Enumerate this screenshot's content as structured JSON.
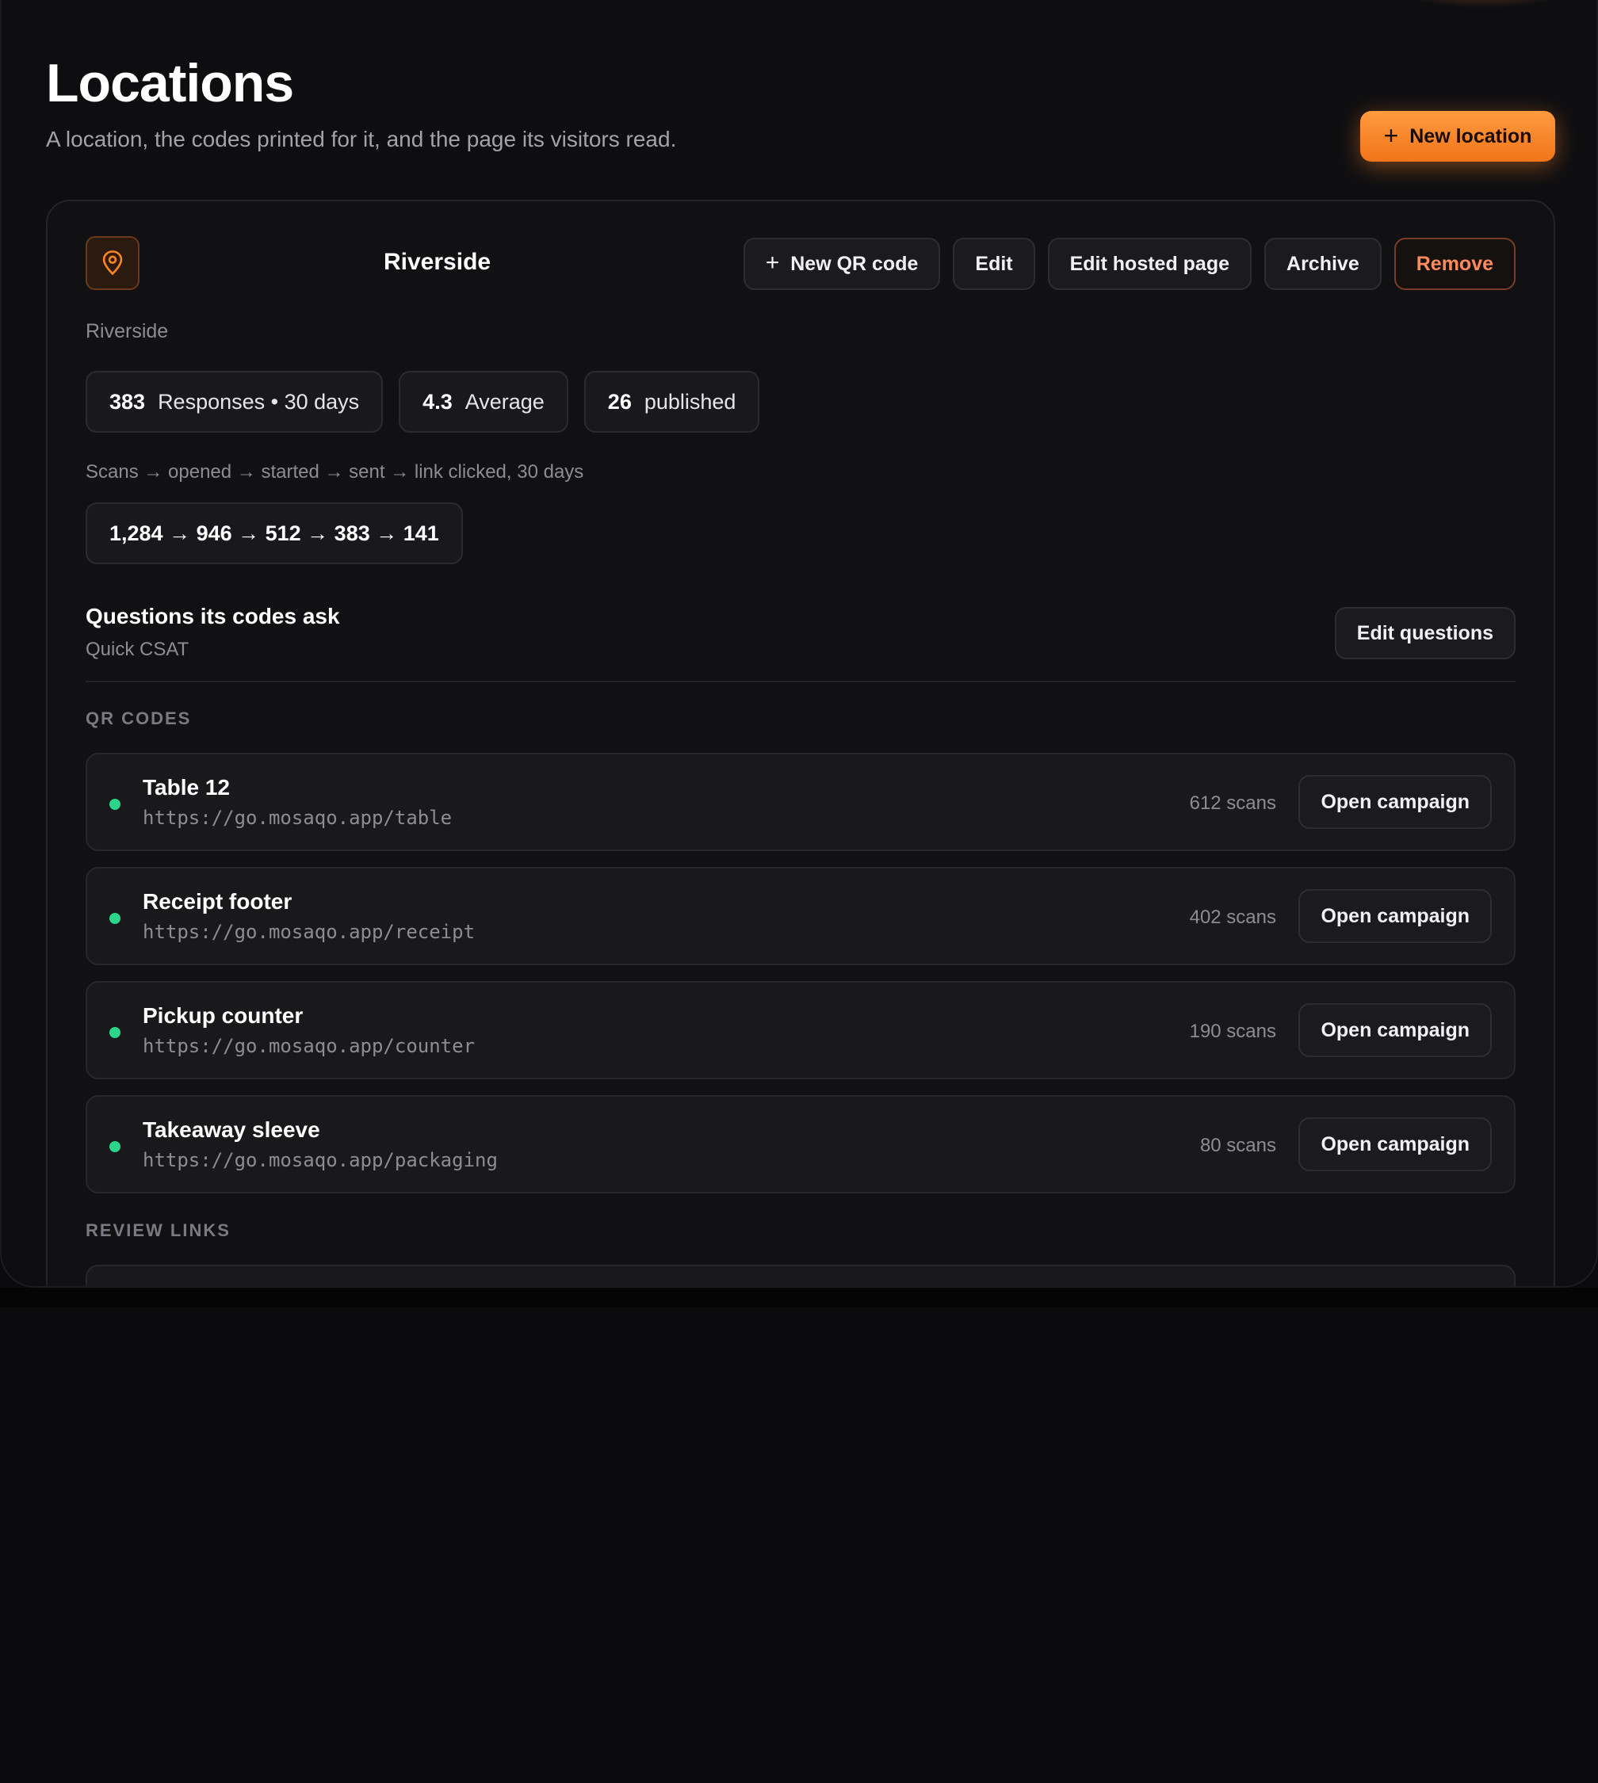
{
  "header": {
    "title": "Locations",
    "subtitle": "A location, the codes printed for it, and the page its visitors read.",
    "new_location_label": "New location"
  },
  "colors": {
    "accent": "#f7841f",
    "danger": "#ff8a5c",
    "status_active": "#2ad48a",
    "background": "#0e0e11"
  },
  "location": {
    "name": "Riverside",
    "sub": "Riverside",
    "icon": "map-pin-icon",
    "actions": {
      "new_qr": "New QR code",
      "edit": "Edit",
      "edit_hosted": "Edit hosted page",
      "archive": "Archive",
      "remove": "Remove"
    },
    "stats": [
      {
        "value": "383",
        "label": "Responses • 30 days"
      },
      {
        "value": "4.3",
        "label": "Average"
      },
      {
        "value": "26",
        "label": "published"
      }
    ],
    "funnel_label": "Scans → opened → started → sent → link clicked, 30 days",
    "funnel_values": "1,284 → 946 → 512 → 383 → 141",
    "questions": {
      "title": "Questions its codes ask",
      "sub": "Quick CSAT",
      "edit_label": "Edit questions"
    },
    "qr_section_label": "QR CODES",
    "qr_codes": [
      {
        "name": "Table 12",
        "url": "https://go.mosaqo.app/table",
        "scans": "612 scans",
        "action": "Open campaign"
      },
      {
        "name": "Receipt footer",
        "url": "https://go.mosaqo.app/receipt",
        "scans": "402 scans",
        "action": "Open campaign"
      },
      {
        "name": "Pickup counter",
        "url": "https://go.mosaqo.app/counter",
        "scans": "190 scans",
        "action": "Open campaign"
      },
      {
        "name": "Takeaway sleeve",
        "url": "https://go.mosaqo.app/packaging",
        "scans": "80 scans",
        "action": "Open campaign"
      }
    ],
    "review_section_label": "REVIEW LINKS"
  }
}
